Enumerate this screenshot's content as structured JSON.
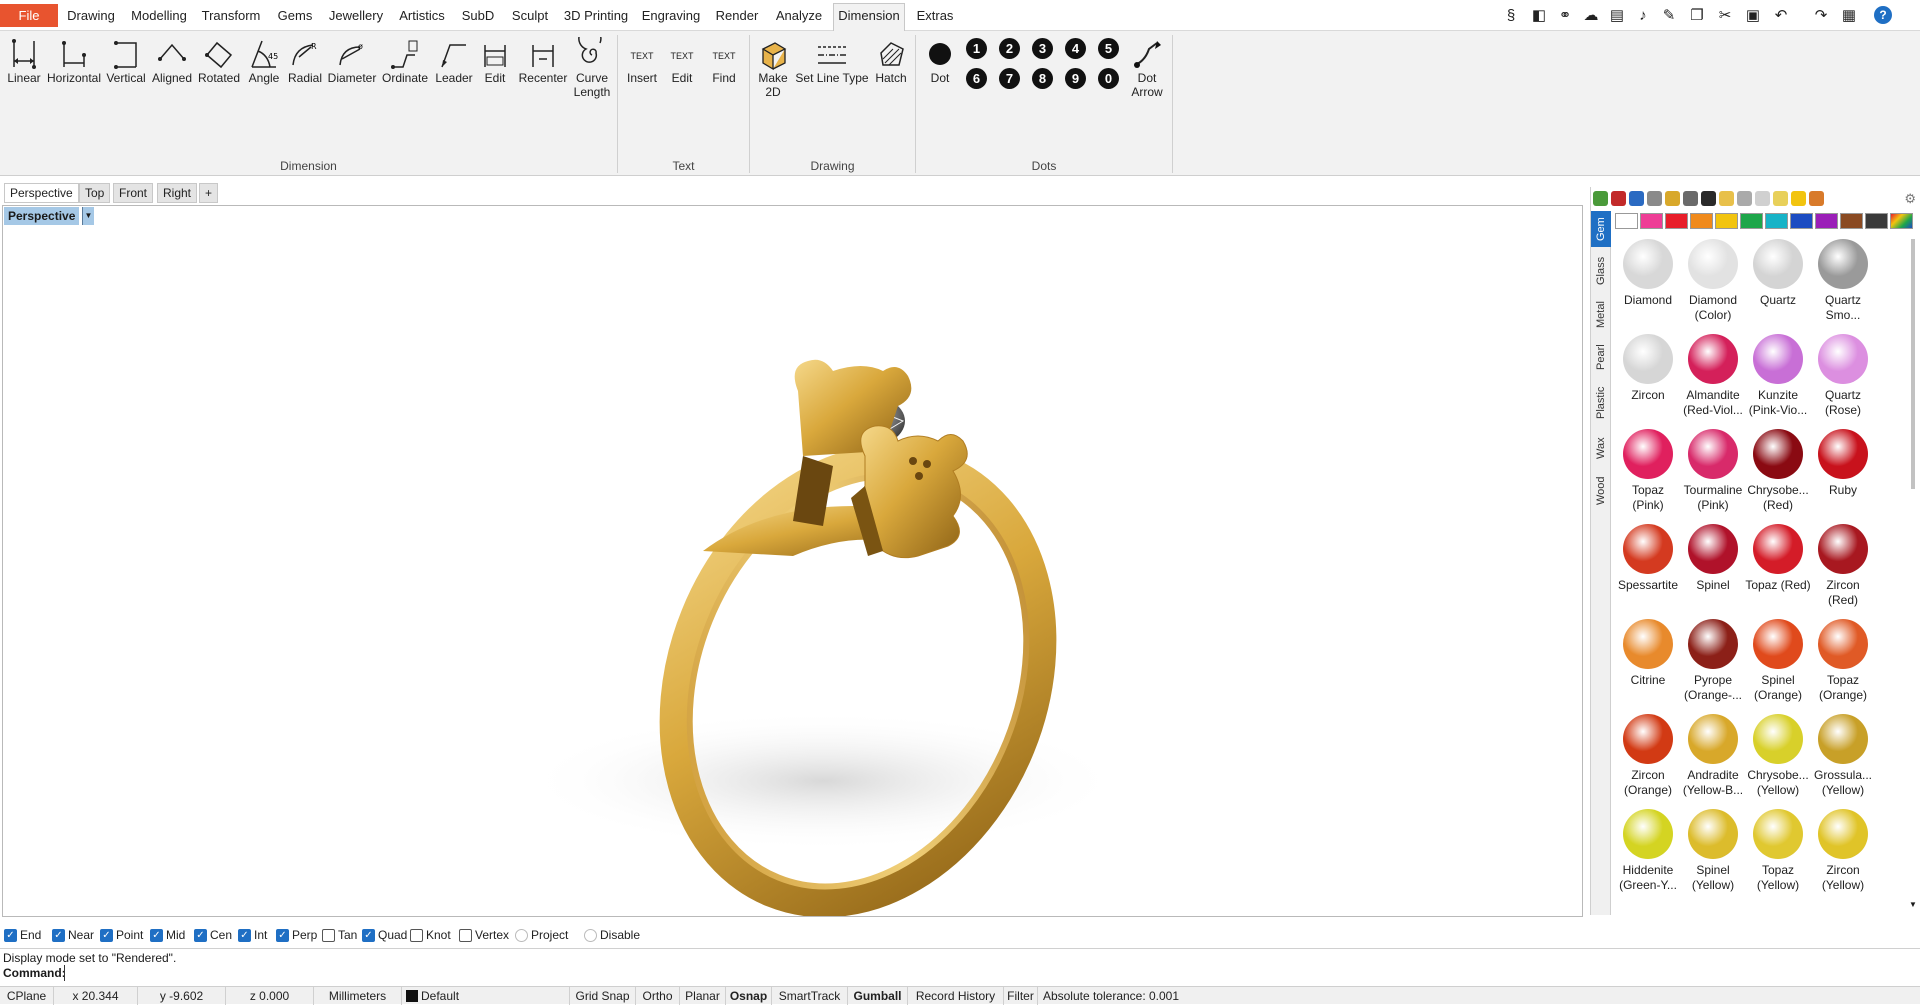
{
  "menu": {
    "file": "File",
    "items": [
      "Drawing",
      "Modelling",
      "Transform",
      "Gems",
      "Jewellery",
      "Artistics",
      "SubD",
      "Sculpt",
      "3D Printing",
      "Engraving",
      "Render",
      "Analyze",
      "Dimension",
      "Extras"
    ],
    "active": "Dimension"
  },
  "top_tools": [
    "grasshopper-icon",
    "layer-icon",
    "link-icon",
    "cloud-icon",
    "film-icon",
    "microphone-icon",
    "edit-icon",
    "copy-icon",
    "cut-icon",
    "paste-icon",
    "undo-icon",
    "redo-icon",
    "save-icon",
    "help-icon"
  ],
  "ribbon": {
    "dimension_buttons": [
      "Linear",
      "Horizontal",
      "Vertical",
      "Aligned",
      "Rotated",
      "Angle",
      "Radial",
      "Diameter",
      "Ordinate",
      "Leader",
      "Edit",
      "Recenter",
      "Curve\nLength"
    ],
    "dimension_group": "Dimension",
    "text_buttons": [
      "Insert",
      "Edit",
      "Find"
    ],
    "text_icon_labels": [
      "TEXT",
      "TEXT",
      "TEXT"
    ],
    "text_group": "Text",
    "drawing_buttons": [
      "Make\n2D",
      "Set Line Type",
      "Hatch"
    ],
    "drawing_group": "Drawing",
    "dots_buttons": [
      "Dot",
      "Dot\nArrow"
    ],
    "dot_numbers": [
      "1",
      "2",
      "3",
      "4",
      "5",
      "6",
      "7",
      "8",
      "9",
      "0"
    ],
    "dots_group": "Dots"
  },
  "viewport_tabs": [
    "Perspective",
    "Top",
    "Front",
    "Right",
    "+"
  ],
  "viewport": {
    "title": "Perspective",
    "colors": {
      "gold": "#d9a83c",
      "gold_dark": "#8a5f14"
    }
  },
  "panel": {
    "vertical_tabs": [
      "Gem",
      "Glass",
      "Metal",
      "Pearl",
      "Plastic",
      "Wax",
      "Wood"
    ],
    "active_tab": "Gem",
    "swatches": [
      "#ffffff",
      "#ee3d96",
      "#e81e2a",
      "#f08a1c",
      "#f2c40f",
      "#1ea64a",
      "#17b3c7",
      "#1c4cc2",
      "#9b1fb8",
      "#8a4a22",
      "#3a3a3a",
      "#rainbow"
    ],
    "gems": [
      {
        "label": "Diamond",
        "color": "#d8d8d8"
      },
      {
        "label": "Diamond\n(Color)",
        "color": "#e2e2e2"
      },
      {
        "label": "Quartz",
        "color": "#d4d4d4"
      },
      {
        "label": "Quartz\nSmo...",
        "color": "#9a9a9a"
      },
      {
        "label": "Zircon",
        "color": "#d6d6d6"
      },
      {
        "label": "Almandite\n(Red-Viol...",
        "color": "#d4205a"
      },
      {
        "label": "Kunzite\n(Pink-Vio...",
        "color": "#c86fd6"
      },
      {
        "label": "Quartz\n(Rose)",
        "color": "#dc8fe0"
      },
      {
        "label": "Topaz\n(Pink)",
        "color": "#e0205e"
      },
      {
        "label": "Tourmaline\n(Pink)",
        "color": "#d82a6a"
      },
      {
        "label": "Chrysobe...\n(Red)",
        "color": "#8a0a12"
      },
      {
        "label": "Ruby",
        "color": "#c8121c"
      },
      {
        "label": "Spessartite",
        "color": "#d43a20"
      },
      {
        "label": "Spinel",
        "color": "#b0122a"
      },
      {
        "label": "Topaz (Red)",
        "color": "#d41c28"
      },
      {
        "label": "Zircon\n(Red)",
        "color": "#a81820"
      },
      {
        "label": "Citrine",
        "color": "#e88a2c"
      },
      {
        "label": "Pyrope\n(Orange-...",
        "color": "#8c2018"
      },
      {
        "label": "Spinel\n(Orange)",
        "color": "#e04a1c"
      },
      {
        "label": "Topaz\n(Orange)",
        "color": "#e05a26"
      },
      {
        "label": "Zircon\n(Orange)",
        "color": "#d23a14"
      },
      {
        "label": "Andradite\n(Yellow-B...",
        "color": "#d8a82a"
      },
      {
        "label": "Chrysobe...\n(Yellow)",
        "color": "#d8d02a"
      },
      {
        "label": "Grossula...\n(Yellow)",
        "color": "#c8a028"
      },
      {
        "label": "Hiddenite\n(Green-Y...",
        "color": "#d4d422"
      },
      {
        "label": "Spinel\n(Yellow)",
        "color": "#dcbc2c"
      },
      {
        "label": "Topaz\n(Yellow)",
        "color": "#e0c830"
      },
      {
        "label": "Zircon\n(Yellow)",
        "color": "#e0c428"
      }
    ]
  },
  "osnap": {
    "items": [
      {
        "label": "End",
        "checked": true
      },
      {
        "label": "Near",
        "checked": true
      },
      {
        "label": "Point",
        "checked": true
      },
      {
        "label": "Mid",
        "checked": true
      },
      {
        "label": "Cen",
        "checked": true
      },
      {
        "label": "Int",
        "checked": true
      },
      {
        "label": "Perp",
        "checked": true
      },
      {
        "label": "Tan",
        "checked": false
      },
      {
        "label": "Quad",
        "checked": true
      },
      {
        "label": "Knot",
        "checked": false
      },
      {
        "label": "Vertex",
        "checked": false
      },
      {
        "label": "Project",
        "checked": false
      },
      {
        "label": "Disable",
        "checked": false
      }
    ]
  },
  "command": {
    "history": "Display mode set to \"Rendered\".",
    "prompt": "Command:",
    "value": ""
  },
  "status": {
    "cplane": "CPlane",
    "x": "x 20.344",
    "y": "y -9.602",
    "z": "z 0.000",
    "units": "Millimeters",
    "layer": "Default",
    "grid_snap": "Grid Snap",
    "ortho": "Ortho",
    "planar": "Planar",
    "osnap": "Osnap",
    "smarttrack": "SmartTrack",
    "gumball": "Gumball",
    "record_history": "Record History",
    "filter": "Filter",
    "tolerance": "Absolute tolerance: 0.001"
  }
}
